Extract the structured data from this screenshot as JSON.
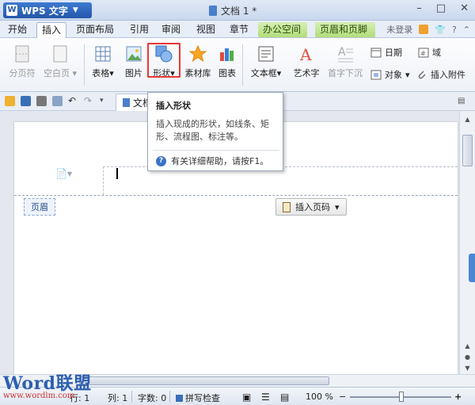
{
  "titlebar": {
    "app_button": "WPS 文字",
    "doc_title": "文档 1 *"
  },
  "menu": {
    "tabs": [
      {
        "label": "开始"
      },
      {
        "label": "插入"
      },
      {
        "label": "页面布局"
      },
      {
        "label": "引用"
      },
      {
        "label": "审阅"
      },
      {
        "label": "视图"
      },
      {
        "label": "章节"
      },
      {
        "label": "办公空间"
      },
      {
        "label": "页眉和页脚"
      }
    ],
    "login": "未登录"
  },
  "ribbon": {
    "page_break": "分页符",
    "blank_page": "空白页",
    "table": "表格",
    "picture": "图片",
    "shape": "形状",
    "material": "素材库",
    "chart": "图表",
    "textbox": "文本框",
    "wordart": "艺术字",
    "drop_cap": "首字下沉",
    "date": "日期",
    "field": "域",
    "object": "对象",
    "attachment": "插入附件"
  },
  "doc_tab": "文档",
  "tooltip": {
    "title": "插入形状",
    "body": "插入现成的形状，如线条、矩形、流程图、标注等。",
    "help": "有关详细帮助，请按F1。"
  },
  "page": {
    "header_label": "页眉",
    "insert_page_number": "插入页码"
  },
  "status": {
    "row": "行: 1",
    "col": "列: 1",
    "words": "字数: 0",
    "spell": "拼写检查",
    "zoom": "100 %"
  },
  "logo": {
    "brand_a": "Word",
    "brand_b": "联盟",
    "url": "www.wordlm.com"
  }
}
